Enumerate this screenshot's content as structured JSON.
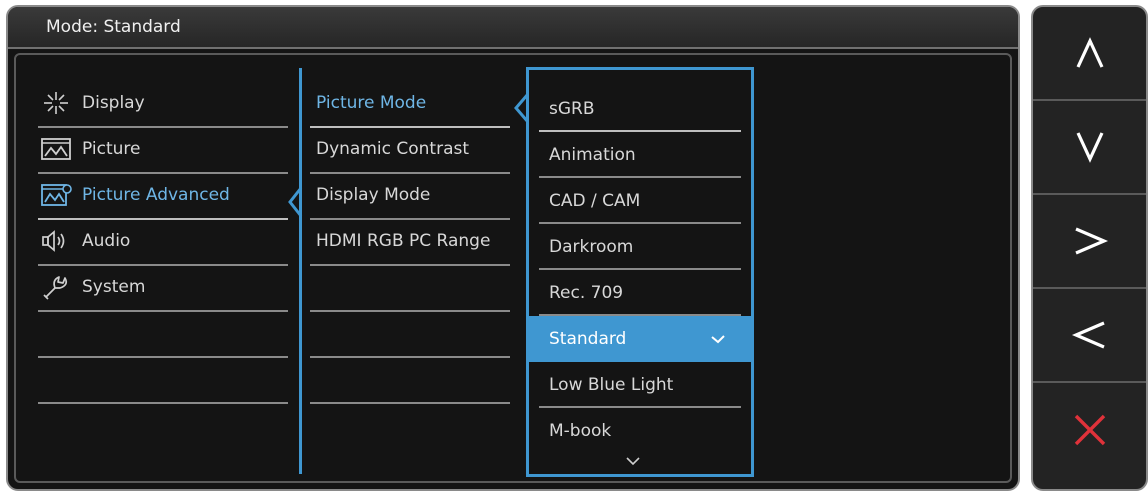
{
  "title": "Mode: Standard",
  "menu": {
    "items": [
      {
        "label": "Display",
        "icon": "display-icon"
      },
      {
        "label": "Picture",
        "icon": "picture-icon"
      },
      {
        "label": "Picture Advanced",
        "icon": "picture-advanced-icon"
      },
      {
        "label": "Audio",
        "icon": "audio-icon"
      },
      {
        "label": "System",
        "icon": "system-icon"
      }
    ],
    "active": "Picture Advanced"
  },
  "submenu": {
    "items": [
      "Picture Mode",
      "Dynamic Contrast",
      "Display Mode",
      "HDMI RGB PC Range"
    ],
    "active": "Picture Mode"
  },
  "options": {
    "items": [
      "sGRB",
      "Animation",
      "CAD / CAM",
      "Darkroom",
      "Rec. 709",
      "Standard",
      "Low Blue Light",
      "M-book"
    ],
    "selected": "Standard"
  },
  "controls": [
    {
      "icon": "up-arrow-icon"
    },
    {
      "icon": "down-arrow-icon"
    },
    {
      "icon": "right-arrow-icon"
    },
    {
      "icon": "left-arrow-icon"
    },
    {
      "icon": "close-icon"
    }
  ],
  "colors": {
    "accent": "#3f97d1",
    "background": "#141414",
    "close": "#e0323a"
  }
}
